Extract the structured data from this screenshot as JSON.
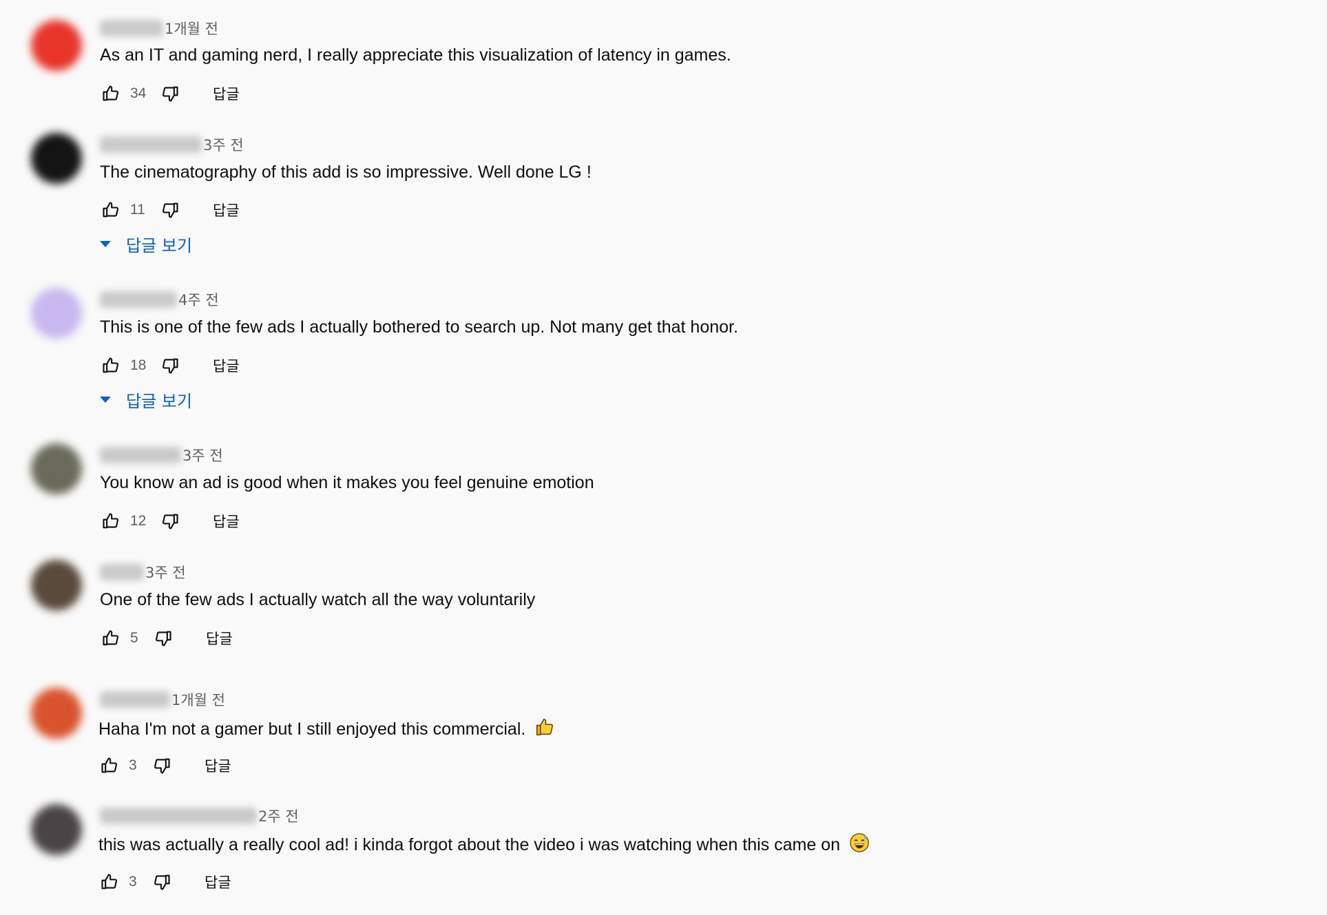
{
  "labels": {
    "reply": "답글",
    "view_replies": "답글 보기"
  },
  "comments": [
    {
      "time": "1개월 전",
      "text": "As an IT and gaming nerd, I really appreciate this visualization of latency in games.",
      "likes": "34",
      "avatar_color": "#e8362b",
      "emoji": ""
    },
    {
      "time": "3주 전",
      "text": "The cinematography of this add is so impressive. Well done LG !",
      "likes": "11",
      "avatar_color": "#141414",
      "emoji": ""
    },
    {
      "time": "4주 전",
      "text": "This is one of the few ads I actually bothered to search up. Not many get that honor.",
      "likes": "18",
      "avatar_color": "#c8b8ef",
      "emoji": ""
    },
    {
      "time": "3주 전",
      "text": "You know an ad is good when it makes you feel genuine emotion",
      "likes": "12",
      "avatar_color": "#6a6a5a",
      "emoji": ""
    },
    {
      "time": "3주 전",
      "text": "One of the few ads I actually watch all the way voluntarily",
      "likes": "5",
      "avatar_color": "#5a4a3c",
      "emoji": ""
    },
    {
      "time": "1개월 전",
      "text": "Haha I'm not a gamer but I still enjoyed this commercial.",
      "likes": "3",
      "avatar_color": "#d9542e",
      "emoji": "thumbs-up"
    },
    {
      "time": "2주 전",
      "text": "this was actually a really cool ad! i kinda forgot about the video i was watching when this came on",
      "likes": "3",
      "avatar_color": "#4a4446",
      "emoji": "sweat-smile"
    }
  ],
  "icons": {
    "like": "thumbs-up-outline-icon",
    "dislike": "thumbs-down-outline-icon",
    "caret": "caret-down-icon"
  },
  "colors": {
    "link_blue": "#065fd4",
    "background": "#f9f9f9"
  }
}
